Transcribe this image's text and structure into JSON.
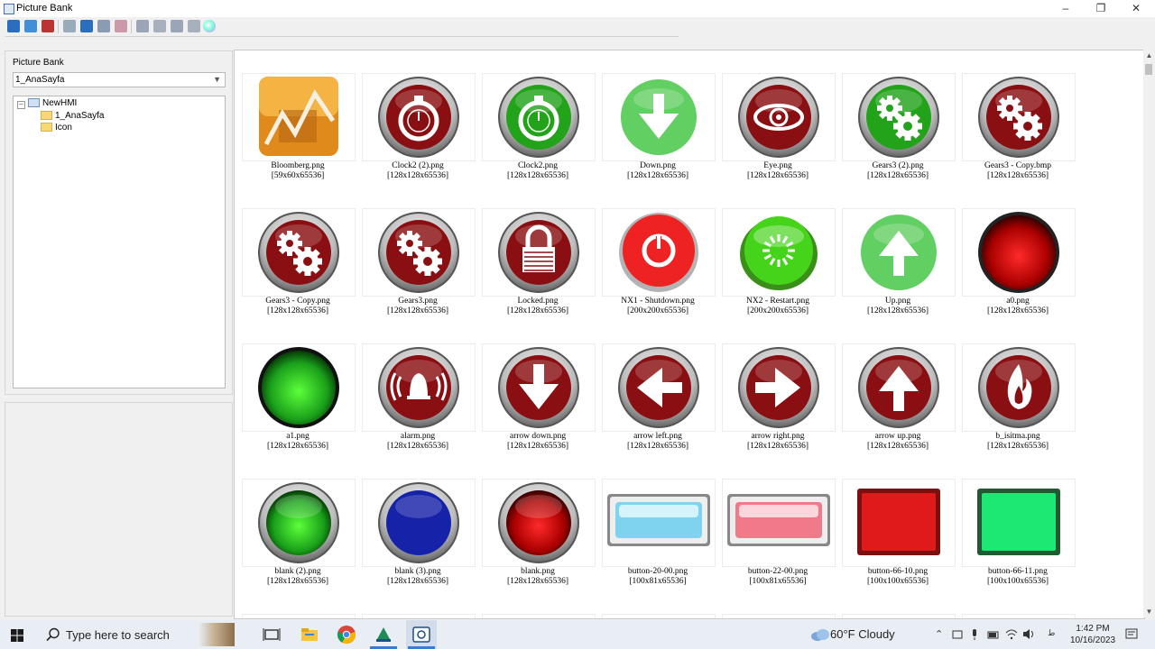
{
  "window": {
    "title": "Picture Bank",
    "minimize": "–",
    "restore": "❐",
    "close": "✕"
  },
  "toolbar": {
    "icons": [
      "open-icon",
      "add-picture-icon",
      "delete-picture-icon",
      "refresh-icon",
      "import-icon",
      "export-icon",
      "remove-icon",
      "align-left-icon",
      "resize-icon",
      "columns-icon",
      "rows-icon",
      "color-icon"
    ]
  },
  "left_panel": {
    "label": "Picture Bank",
    "combo_value": "1_AnaSayfa",
    "tree": {
      "root": "NewHMI",
      "children": [
        "1_AnaSayfa",
        "Icon"
      ]
    }
  },
  "colors": {
    "dark_red": "#8a0f12",
    "green": "#22a31a",
    "light_green": "#62cf62",
    "blue": "#1622a8",
    "silver": "#c8c8c8"
  },
  "pictures": [
    {
      "name": "Bloomberg.png",
      "size": "[59x60x65536]",
      "icon": "bloomberg-chart-icon"
    },
    {
      "name": "Clock2 (2).png",
      "size": "[128x128x65536]",
      "icon": "stopwatch-red-icon"
    },
    {
      "name": "Clock2.png",
      "size": "[128x128x65536]",
      "icon": "stopwatch-green-icon"
    },
    {
      "name": "Down.png",
      "size": "[128x128x65536]",
      "icon": "down-arrow-green-icon"
    },
    {
      "name": "Eye.png",
      "size": "[128x128x65536]",
      "icon": "eye-red-icon"
    },
    {
      "name": "Gears3 (2).png",
      "size": "[128x128x65536]",
      "icon": "gears-green-icon"
    },
    {
      "name": "Gears3 - Copy.bmp",
      "size": "[128x128x65536]",
      "icon": "gears-red-icon"
    },
    {
      "name": "Gears3 - Copy.png",
      "size": "[128x128x65536]",
      "icon": "gears-red-icon"
    },
    {
      "name": "Gears3.png",
      "size": "[128x128x65536]",
      "icon": "gears-red-icon"
    },
    {
      "name": "Locked.png",
      "size": "[128x128x65536]",
      "icon": "lock-red-icon"
    },
    {
      "name": "NX1 - Shutdown.png",
      "size": "[200x200x65536]",
      "icon": "power-red-icon"
    },
    {
      "name": "NX2 - Restart.png",
      "size": "[200x200x65536]",
      "icon": "restart-green-icon"
    },
    {
      "name": "Up.png",
      "size": "[128x128x65536]",
      "icon": "up-arrow-green-icon"
    },
    {
      "name": "a0.png",
      "size": "[128x128x65536]",
      "icon": "red-ball-icon"
    },
    {
      "name": "a1.png",
      "size": "[128x128x65536]",
      "icon": "green-ball-icon"
    },
    {
      "name": "alarm.png",
      "size": "[128x128x65536]",
      "icon": "alarm-bell-icon"
    },
    {
      "name": "arrow down.png",
      "size": "[128x128x65536]",
      "icon": "arrow-down-red-icon"
    },
    {
      "name": "arrow left.png",
      "size": "[128x128x65536]",
      "icon": "arrow-left-red-icon"
    },
    {
      "name": "arrow right.png",
      "size": "[128x128x65536]",
      "icon": "arrow-right-red-icon"
    },
    {
      "name": "arrow up.png",
      "size": "[128x128x65536]",
      "icon": "arrow-up-red-icon"
    },
    {
      "name": "b_isitma.png",
      "size": "[128x128x65536]",
      "icon": "flame-red-icon"
    },
    {
      "name": "blank (2).png",
      "size": "[128x128x65536]",
      "icon": "blank-green-icon"
    },
    {
      "name": "blank (3).png",
      "size": "[128x128x65536]",
      "icon": "blank-blue-icon"
    },
    {
      "name": "blank.png",
      "size": "[128x128x65536]",
      "icon": "blank-red-icon"
    },
    {
      "name": "button-20-00.png",
      "size": "[100x81x65536]",
      "icon": "button-light-blue-icon"
    },
    {
      "name": "button-22-00.png",
      "size": "[100x81x65536]",
      "icon": "button-pink-icon"
    },
    {
      "name": "button-66-10.png",
      "size": "[100x100x65536]",
      "icon": "button-square-red-icon"
    },
    {
      "name": "button-66-11.png",
      "size": "[100x100x65536]",
      "icon": "button-square-green-icon"
    }
  ],
  "taskbar": {
    "search_placeholder": "Type here to search",
    "weather": "60°F  Cloudy",
    "time": "1:42 PM",
    "date": "10/16/2023"
  }
}
